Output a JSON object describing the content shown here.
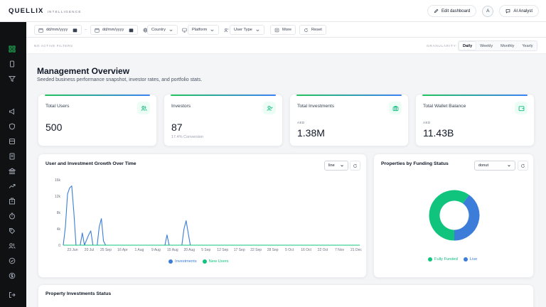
{
  "header": {
    "brand": "QUELLIX",
    "brand_sub": "INTELLIGENCE",
    "edit_dashboard": "Edit dashboard",
    "avatar_initial": "A",
    "ai_analyst": "AI Analyst"
  },
  "filters": {
    "date_from_placeholder": "dd/mm/yyyy",
    "date_separator": "–",
    "date_to_placeholder": "dd/mm/yyyy",
    "country": "Country",
    "platform": "Platform",
    "user_type": "User Type",
    "more": "More",
    "reset": "Reset"
  },
  "status": {
    "no_active_filters": "NO ACTIVE FILTERS",
    "granularity_label": "GRANULARITY:",
    "granularity_options": [
      "Daily",
      "Weekly",
      "Monthly",
      "Yearly"
    ],
    "granularity_selected": "Daily"
  },
  "page": {
    "title": "Management Overview",
    "subtitle": "Seeded business performance snapshot, investor rates, and portfolio stats."
  },
  "stats": [
    {
      "title": "Total Users",
      "value": "500",
      "icon": "users-icon"
    },
    {
      "title": "Investors",
      "value": "87",
      "note": "17.4% Conversion",
      "icon": "user-check-icon"
    },
    {
      "title": "Total Investments",
      "currency": "AED",
      "value": "1.38M",
      "icon": "briefcase-icon"
    },
    {
      "title": "Total Wallet Balance",
      "currency": "AED",
      "value": "11.43B",
      "icon": "wallet-icon"
    }
  ],
  "colors": {
    "accent_green": "#10c47e",
    "accent_blue": "#3b7dd8",
    "sidebar_bg": "#0f1113"
  },
  "growth_chart": {
    "title": "User and Investment Growth Over Time",
    "chart_type_select": "line",
    "legend": [
      "Investments",
      "New Users"
    ]
  },
  "funding_chart": {
    "title": "Properties by Funding Status",
    "chart_type_select": "donut",
    "legend": [
      "Fully Funded",
      "Live"
    ]
  },
  "table": {
    "title": "Property Investments Status"
  },
  "chart_data": [
    {
      "type": "line",
      "title": "User and Investment Growth Over Time",
      "x_ticks": [
        "23 Jun",
        "20 Jul",
        "25 Sep",
        "16 Apr",
        "1 Aug",
        "9 Aug",
        "15 Aug",
        "20 Aug",
        "5 Sep",
        "12 Sep",
        "17 Sep",
        "22 Sep",
        "28 Sep",
        "5 Oct",
        "16 Oct",
        "22 Oct",
        "7 Nov",
        "21 Dec"
      ],
      "y_ticks": [
        "0",
        "4k",
        "8k",
        "12k",
        "16k"
      ],
      "ylim": [
        0,
        16000
      ],
      "series": [
        {
          "name": "Investments",
          "points": [
            [
              0,
              0
            ],
            [
              0.5,
              4500
            ],
            [
              1,
              12500
            ],
            [
              1.5,
              14000
            ],
            [
              2,
              14500
            ],
            [
              2.5,
              8000
            ],
            [
              3,
              0
            ],
            [
              4,
              0
            ],
            [
              4.5,
              3000
            ],
            [
              5,
              0
            ],
            [
              6,
              2500
            ],
            [
              6.5,
              3500
            ],
            [
              7,
              0
            ],
            [
              8,
              0
            ],
            [
              8.5,
              4500
            ],
            [
              9,
              6500
            ],
            [
              9.5,
              1000
            ],
            [
              10,
              0
            ],
            [
              18,
              0
            ],
            [
              24,
              0
            ],
            [
              24.5,
              2500
            ],
            [
              25,
              0
            ],
            [
              28,
              0
            ],
            [
              28.5,
              4000
            ],
            [
              29,
              6000
            ],
            [
              29.5,
              3000
            ],
            [
              30,
              0
            ],
            [
              70,
              0
            ]
          ]
        },
        {
          "name": "New Users",
          "points": [
            [
              0,
              0
            ],
            [
              70,
              0
            ]
          ]
        }
      ],
      "x_range": [
        0,
        70
      ]
    },
    {
      "type": "pie",
      "title": "Properties by Funding Status",
      "categories": [
        "Fully Funded",
        "Live"
      ],
      "values": [
        60,
        40
      ]
    }
  ]
}
